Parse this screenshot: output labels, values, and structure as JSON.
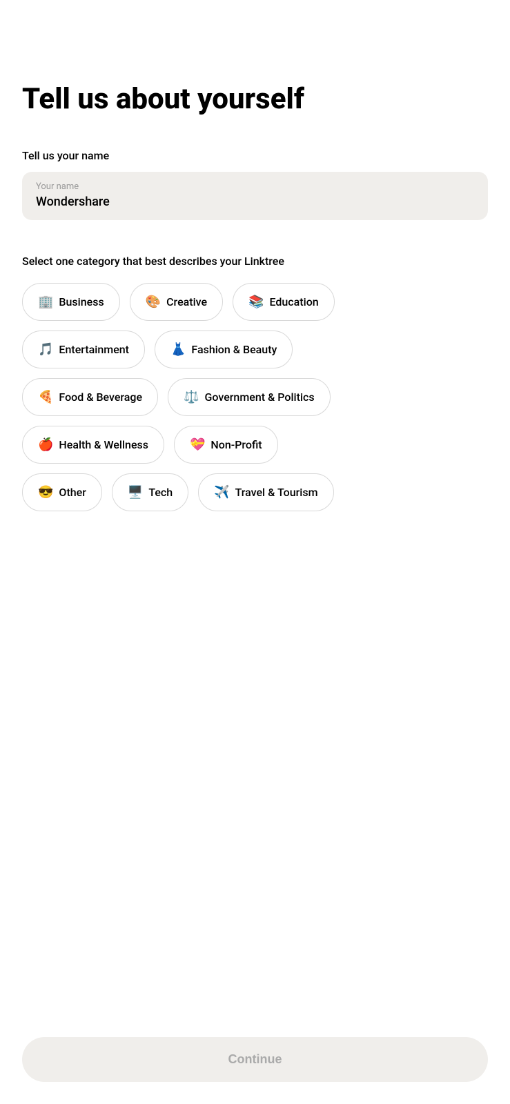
{
  "page": {
    "title": "Tell us about yourself",
    "name_section": {
      "label": "Tell us your name",
      "placeholder": "Your name",
      "value": "Wondershare"
    },
    "category_section": {
      "label": "Select one category that best describes your Linktree",
      "categories": [
        {
          "id": "business",
          "emoji": "🏢",
          "label": "Business"
        },
        {
          "id": "creative",
          "emoji": "🎨",
          "label": "Creative"
        },
        {
          "id": "education",
          "emoji": "📚",
          "label": "Education"
        },
        {
          "id": "entertainment",
          "emoji": "🎵",
          "label": "Entertainment"
        },
        {
          "id": "fashion-beauty",
          "emoji": "👗",
          "label": "Fashion & Beauty"
        },
        {
          "id": "food-beverage",
          "emoji": "🍕",
          "label": "Food & Beverage"
        },
        {
          "id": "government-politics",
          "emoji": "⚖️",
          "label": "Government & Politics"
        },
        {
          "id": "health-wellness",
          "emoji": "🍎",
          "label": "Health & Wellness"
        },
        {
          "id": "non-profit",
          "emoji": "💝",
          "label": "Non-Profit"
        },
        {
          "id": "other",
          "emoji": "😎",
          "label": "Other"
        },
        {
          "id": "tech",
          "emoji": "🖥️",
          "label": "Tech"
        },
        {
          "id": "travel-tourism",
          "emoji": "✈️",
          "label": "Travel & Tourism"
        }
      ]
    },
    "continue_button": {
      "label": "Continue"
    }
  }
}
